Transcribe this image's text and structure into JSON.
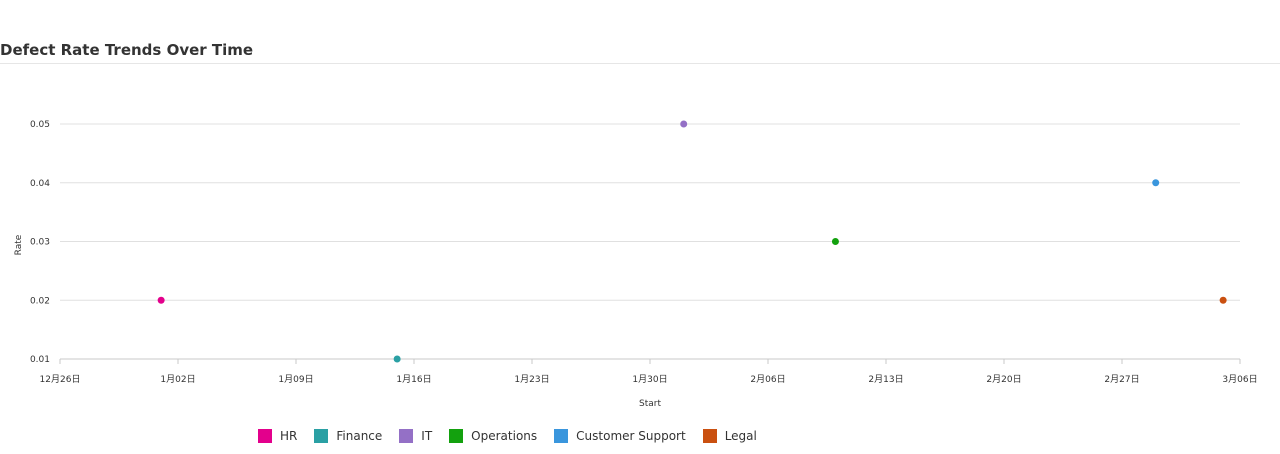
{
  "chart_data": {
    "type": "scatter",
    "title": "Defect Rate Trends Over Time",
    "xlabel": "Start",
    "ylabel": "Rate",
    "xlim": [
      "2022-12-26",
      "2023-03-06"
    ],
    "ylim": [
      0.01,
      0.05
    ],
    "x_ticks": [
      "12月26日",
      "1月02日",
      "1月09日",
      "1月16日",
      "1月23日",
      "1月30日",
      "2月06日",
      "2月13日",
      "2月20日",
      "2月27日",
      "3月06日"
    ],
    "y_ticks": [
      "0.01",
      "0.02",
      "0.03",
      "0.04",
      "0.05"
    ],
    "grid": true,
    "legend_position": "bottom",
    "series": [
      {
        "name": "HR",
        "color": "#e3008c",
        "points": [
          {
            "x": "2023-01-01",
            "y": 0.02
          }
        ]
      },
      {
        "name": "Finance",
        "color": "#2aa0a4",
        "points": [
          {
            "x": "2023-01-15",
            "y": 0.01
          }
        ]
      },
      {
        "name": "IT",
        "color": "#9470c6",
        "points": [
          {
            "x": "2023-02-01",
            "y": 0.05
          }
        ]
      },
      {
        "name": "Operations",
        "color": "#13a10e",
        "points": [
          {
            "x": "2023-02-10",
            "y": 0.03
          }
        ]
      },
      {
        "name": "Customer Support",
        "color": "#3a96dd",
        "points": [
          {
            "x": "2023-03-01",
            "y": 0.04
          }
        ]
      },
      {
        "name": "Legal",
        "color": "#ca5010",
        "points": [
          {
            "x": "2023-03-05",
            "y": 0.02
          }
        ]
      }
    ]
  }
}
